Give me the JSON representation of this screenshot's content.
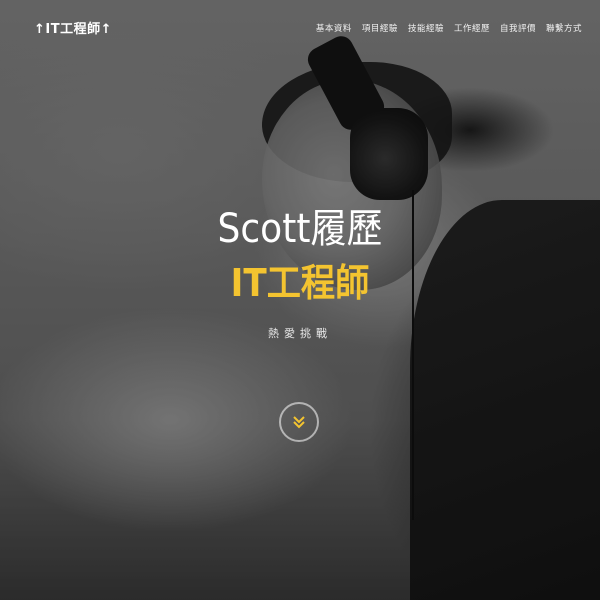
{
  "nav": {
    "brand": "↑IT工程師↑",
    "items": [
      {
        "label": "基本資料"
      },
      {
        "label": "項目經驗"
      },
      {
        "label": "技能經驗"
      },
      {
        "label": "工作經歷"
      },
      {
        "label": "自我評價"
      },
      {
        "label": "聯繫方式"
      }
    ]
  },
  "hero": {
    "title": "Scott履歷",
    "subtitle": "IT工程師",
    "tagline": "熱愛挑戰",
    "scroll_icon": "double-chevron-down-icon"
  },
  "colors": {
    "accent": "#f4c430",
    "text": "#ffffff"
  }
}
